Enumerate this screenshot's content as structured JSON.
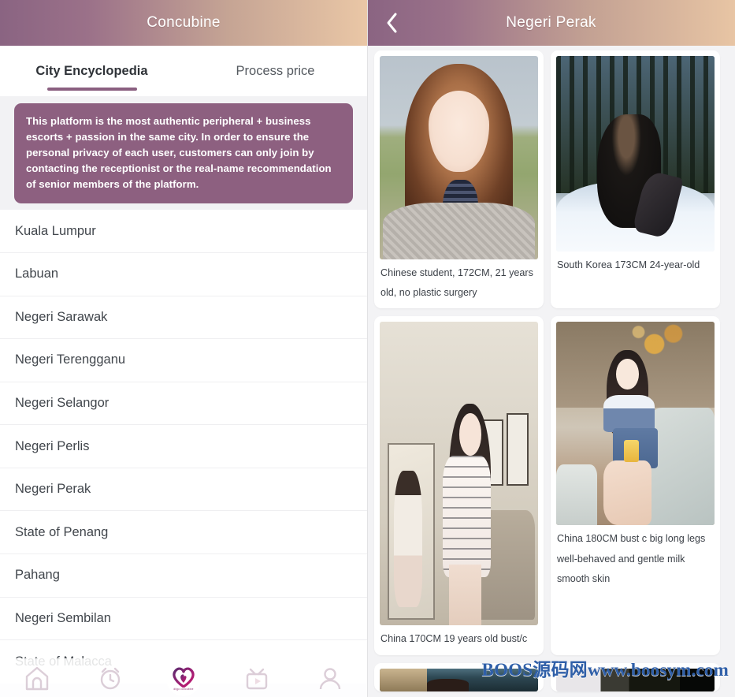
{
  "left_panel": {
    "header": {
      "title": "Concubine"
    },
    "tabs": [
      {
        "label": "City Encyclopedia",
        "active": true
      },
      {
        "label": "Process price",
        "active": false
      }
    ],
    "notice": "This platform is the most authentic peripheral + business escorts + passion in the same city. In order to ensure the personal privacy of each user, customers can only join by contacting the receptionist or the real-name recommendation of senior members of the platform.",
    "cities": [
      "Kuala Lumpur",
      "Labuan",
      "Negeri Sarawak",
      "Negeri Terengganu",
      "Negeri Selangor",
      "Negeri Perlis",
      "Negeri Perak",
      "State of Penang",
      "Pahang",
      "Negeri Sembilan",
      "State of Malacca"
    ],
    "tabbar": [
      {
        "icon": "home-icon",
        "active": false
      },
      {
        "icon": "alarm-clock-icon",
        "active": false
      },
      {
        "icon": "heart-logo-icon",
        "active": true,
        "caption": "diigo concubine"
      },
      {
        "icon": "video-play-icon",
        "active": false
      },
      {
        "icon": "person-icon",
        "active": false
      }
    ]
  },
  "right_panel": {
    "header": {
      "title": "Negeri Perak",
      "back_icon": "chevron-left-icon"
    },
    "cards": [
      {
        "caption": "Chinese student, 172CM, 21 years old, no plastic surgery",
        "photo": "chinese-student-portrait"
      },
      {
        "caption": "South Korea 173CM 24-year-old",
        "photo": "south-korea-snow-portrait"
      },
      {
        "caption": "China 170CM 19 years old bust/c",
        "photo": "china-mirror-selfie-portrait"
      },
      {
        "caption": "China 180CM bust c big long legs well-behaved and gentle milk smooth skin",
        "photo": "china-blue-dress-portrait"
      },
      {
        "caption": "",
        "photo": "partial-card-photo-left"
      },
      {
        "caption": "",
        "photo": "partial-card-photo-right"
      }
    ]
  },
  "watermark": {
    "text": "BOOS源码网www.boosym.com"
  },
  "colors": {
    "header_gradient_start": "#8a6482",
    "header_gradient_end": "#e8c5a4",
    "notice_bg": "#8d6080",
    "tab_underline": "#8a5f80",
    "watermark": "#2f5fa8",
    "page_bg": "#f2f2f4"
  }
}
